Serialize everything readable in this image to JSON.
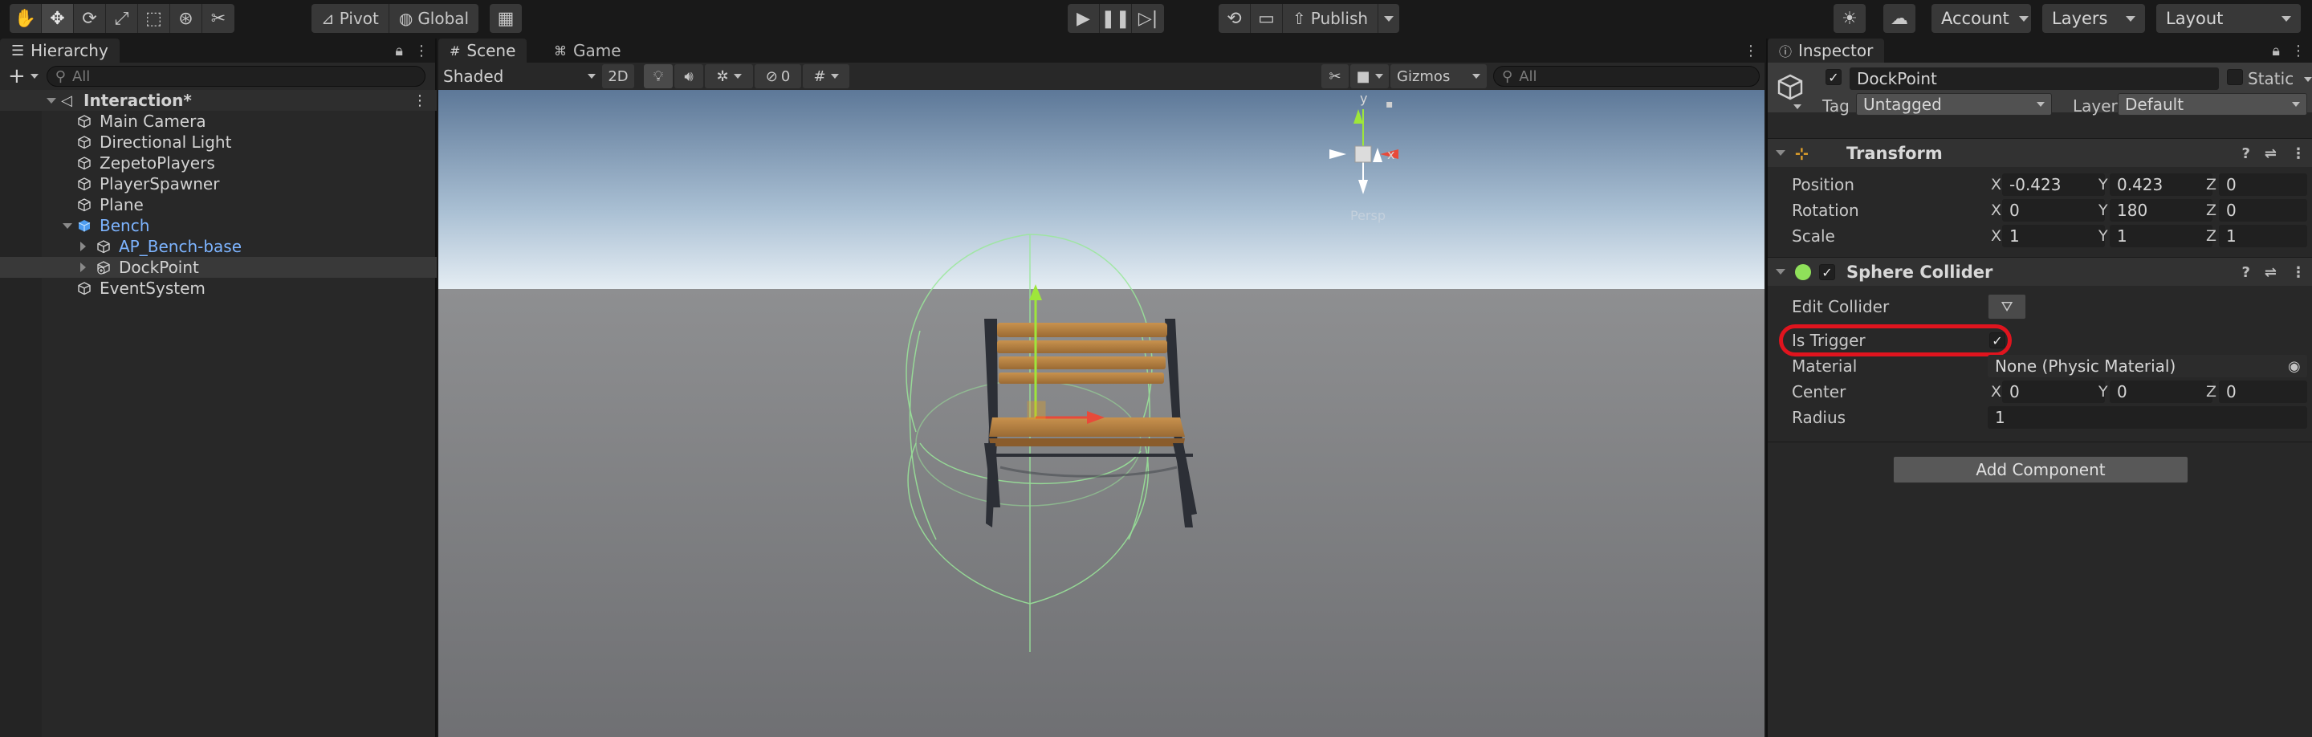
{
  "toolbar": {
    "pivot_label": "Pivot",
    "global_label": "Global",
    "publish_label": "Publish",
    "account_label": "Account",
    "layers_label": "Layers",
    "layout_label": "Layout"
  },
  "hierarchy": {
    "tab_label": "Hierarchy",
    "search_placeholder": "All",
    "root": "Interaction*",
    "items": [
      {
        "label": "Main Camera"
      },
      {
        "label": "Directional Light"
      },
      {
        "label": "ZepetoPlayers"
      },
      {
        "label": "PlayerSpawner"
      },
      {
        "label": "Plane"
      },
      {
        "label": "Bench"
      },
      {
        "label": "AP_Bench-base"
      },
      {
        "label": "DockPoint"
      },
      {
        "label": "EventSystem"
      }
    ]
  },
  "scene": {
    "tabs": [
      "Scene",
      "Game"
    ],
    "shading_mode": "Shaded",
    "twod_label": "2D",
    "hidden_count": "0",
    "gizmos_label": "Gizmos",
    "search_placeholder": "All",
    "gizmo_y_label": "y",
    "gizmo_x_label": "x",
    "persp_label": "Persp"
  },
  "inspector": {
    "tab_label": "Inspector",
    "object_name": "DockPoint",
    "static_label": "Static",
    "tag_label": "Tag",
    "tag_value": "Untagged",
    "layer_label": "Layer",
    "layer_value": "Default",
    "transform": {
      "title": "Transform",
      "position_label": "Position",
      "rotation_label": "Rotation",
      "scale_label": "Scale",
      "position": {
        "x": "-0.423",
        "y": "0.423",
        "z": "0"
      },
      "rotation": {
        "x": "0",
        "y": "180",
        "z": "0"
      },
      "scale": {
        "x": "1",
        "y": "1",
        "z": "1"
      }
    },
    "sphere_collider": {
      "title": "Sphere Collider",
      "edit_collider_label": "Edit Collider",
      "is_trigger_label": "Is Trigger",
      "is_trigger_checked": true,
      "material_label": "Material",
      "material_value": "None (Physic Material)",
      "center_label": "Center",
      "center": {
        "x": "0",
        "y": "0",
        "z": "0"
      },
      "radius_label": "Radius",
      "radius_value": "1"
    },
    "add_component_label": "Add Component",
    "axes": {
      "x": "X",
      "y": "Y",
      "z": "Z"
    }
  },
  "colors": {
    "highlight_ring": "#e0141e",
    "prefab_blue": "#7db4ff",
    "bench_wood": "#b07a3f"
  }
}
